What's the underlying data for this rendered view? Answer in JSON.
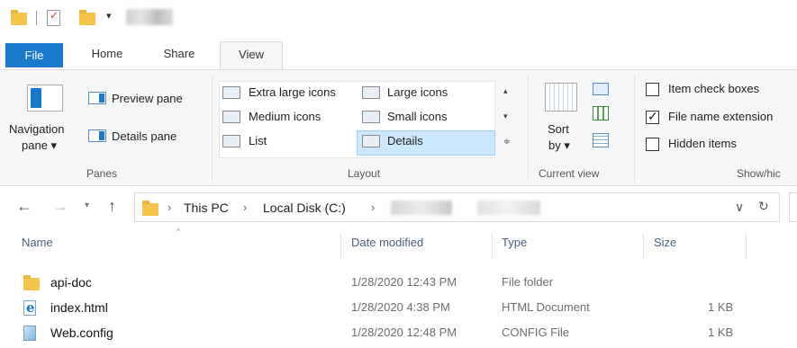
{
  "tabs": {
    "file": "File",
    "home": "Home",
    "share": "Share",
    "view": "View"
  },
  "ribbon": {
    "panes": {
      "navigation_pane_line1": "Navigation",
      "navigation_pane_line2": "pane ▾",
      "preview_pane": "Preview pane",
      "details_pane": "Details pane",
      "label": "Panes"
    },
    "layout": {
      "items": [
        "Extra large icons",
        "Large icons",
        "Medium icons",
        "Small icons",
        "List",
        "Details"
      ],
      "selected": "Details",
      "label": "Layout"
    },
    "current_view": {
      "sort_line1": "Sort",
      "sort_line2": "by ▾",
      "label": "Current view"
    },
    "show_hide": {
      "item_check_boxes": "Item check boxes",
      "file_name_extensions": "File name extension",
      "hidden_items": "Hidden items",
      "label": "Show/hic",
      "checked": {
        "item_check_boxes": false,
        "file_name_extensions": true,
        "hidden_items": false
      }
    }
  },
  "address": {
    "crumbs": [
      "This PC",
      "Local Disk (C:)"
    ],
    "dropdown_glyph": "∨",
    "refresh_glyph": "↻"
  },
  "file_list": {
    "columns": [
      "Name",
      "Date modified",
      "Type",
      "Size"
    ],
    "rows": [
      {
        "name": "api-doc",
        "date": "1/28/2020 12:43 PM",
        "type": "File folder",
        "size": "",
        "icon": "folder-icon"
      },
      {
        "name": "index.html",
        "date": "1/28/2020 4:38 PM",
        "type": "HTML Document",
        "size": "1 KB",
        "icon": "html-file-icon"
      },
      {
        "name": "Web.config",
        "date": "1/28/2020 12:48 PM",
        "type": "CONFIG File",
        "size": "1 KB",
        "icon": "config-file-icon"
      }
    ]
  },
  "colors": {
    "accent": "#1979ca",
    "selection": "#cce8ff",
    "ribbon_bg": "#f5f6f7"
  }
}
